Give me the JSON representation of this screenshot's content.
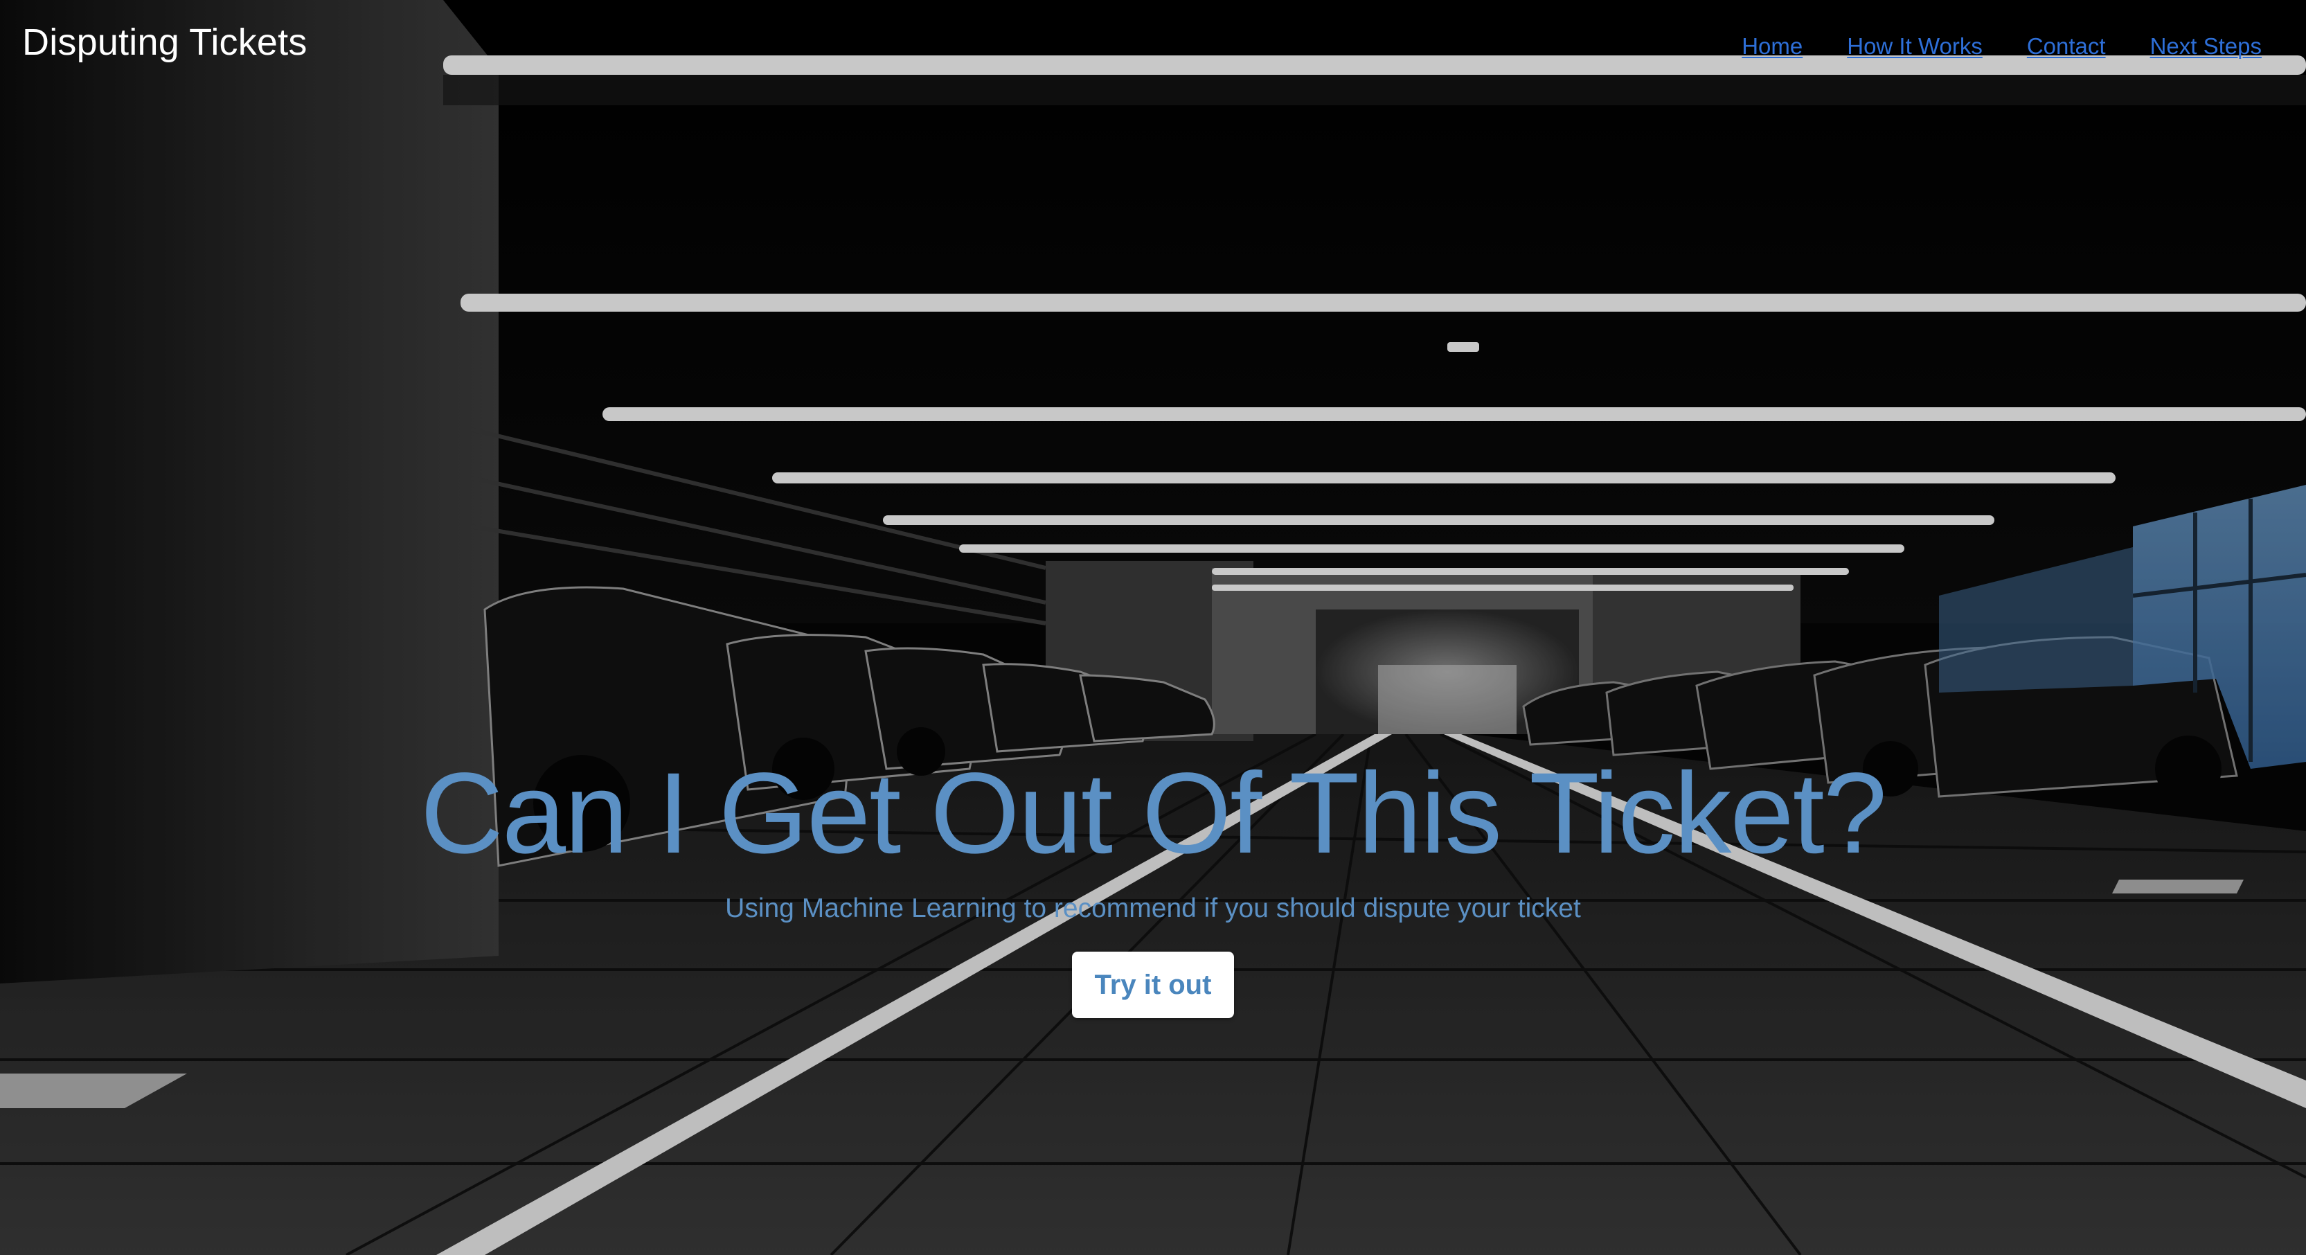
{
  "header": {
    "brand": "Disputing Tickets",
    "nav": [
      {
        "label": "Home"
      },
      {
        "label": "How It Works"
      },
      {
        "label": "Contact"
      },
      {
        "label": "Next Steps"
      }
    ]
  },
  "hero": {
    "title": "Can I Get Out Of This Ticket?",
    "subtitle": "Using Machine Learning to recommend if you should dispute your ticket",
    "cta_label": "Try it out",
    "background_image": "parking-garage-photo"
  },
  "colors": {
    "nav_link": "#2e6fd8",
    "hero_text": "#5b90c4",
    "cta_text": "#4a86bd",
    "cta_bg": "#ffffff"
  }
}
